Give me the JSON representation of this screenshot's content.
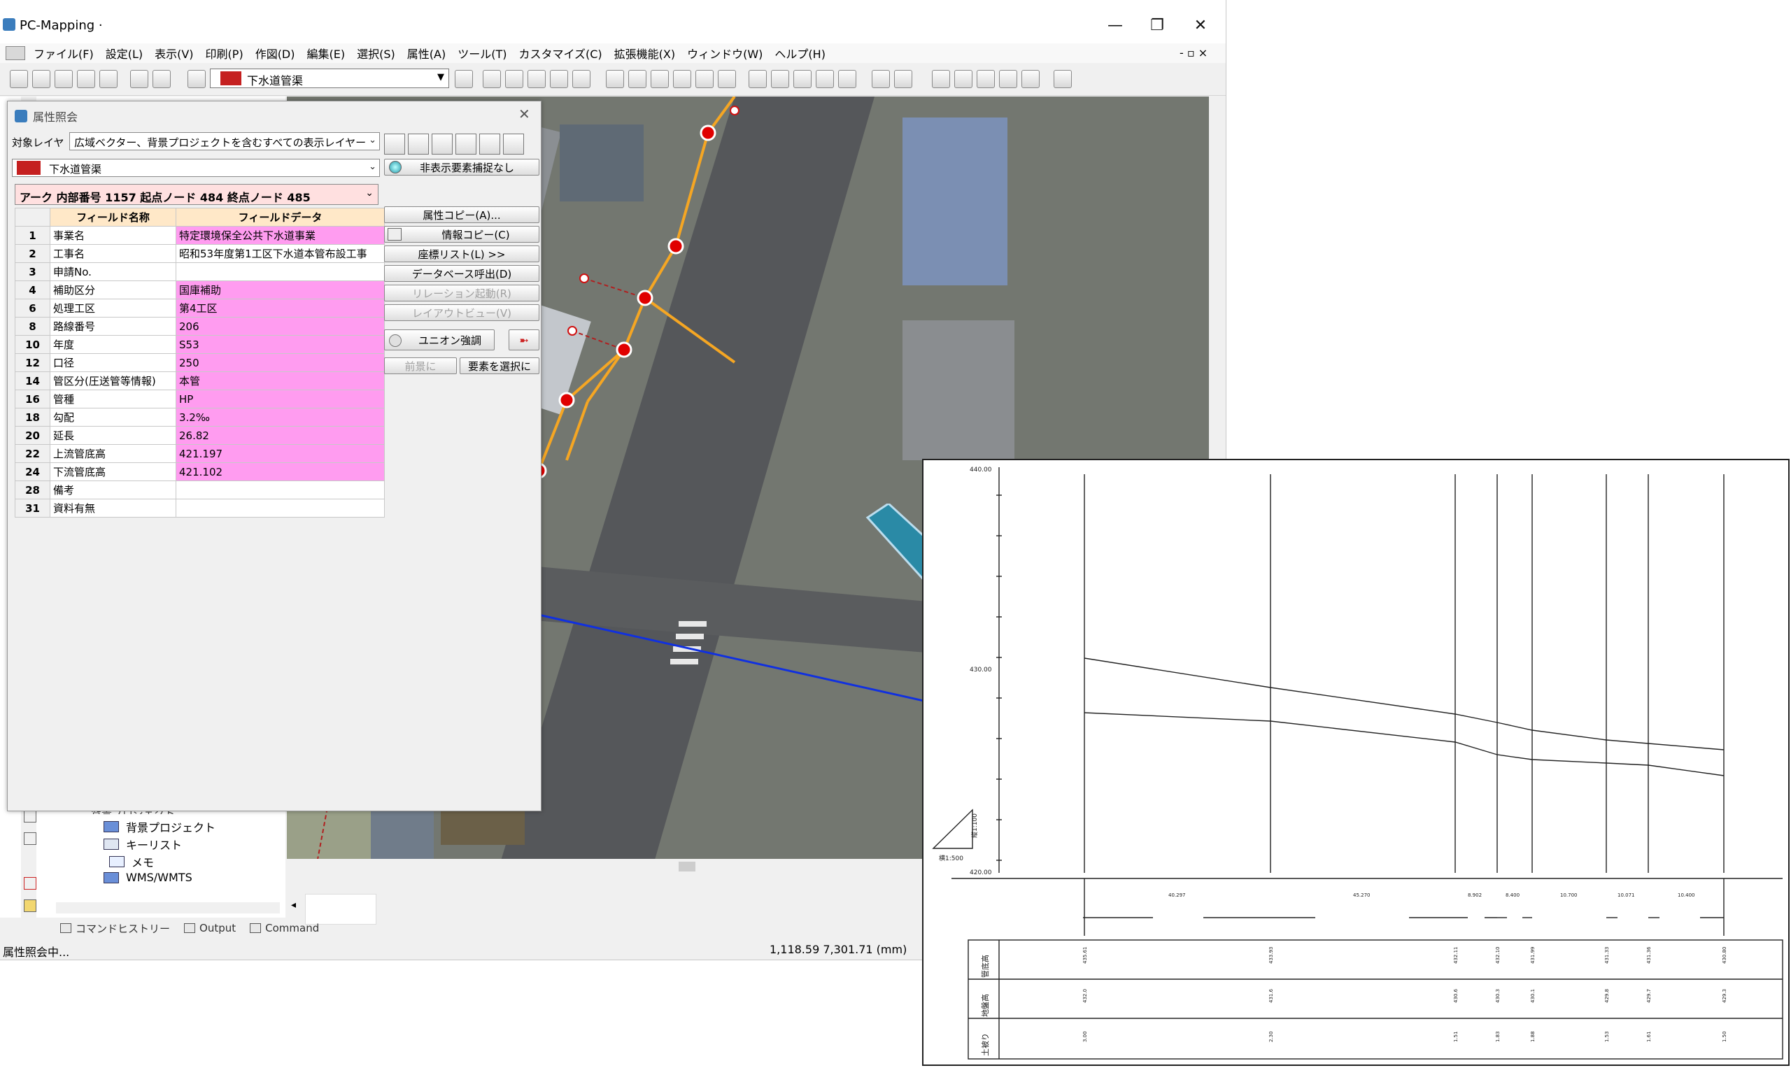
{
  "app": {
    "title": "PC-Mapping ·",
    "menu": [
      "ファイル(F)",
      "設定(L)",
      "表示(V)",
      "印刷(P)",
      "作図(D)",
      "編集(E)",
      "選択(S)",
      "属性(A)",
      "ツール(T)",
      "カスタマイズ(C)",
      "拡張機能(X)",
      "ウィンドウ(W)",
      "ヘルプ(H)"
    ],
    "window_buttons": {
      "minimize": "—",
      "restore": "❐",
      "close": "✕"
    },
    "inner_buttons": "- ▫ ×",
    "toolbar": {
      "layer_combo_value": "下水道管渠"
    }
  },
  "tree": {
    "cut_item": "背景プロジェクト",
    "items": [
      {
        "label": "背景プロジェクト",
        "icon": "folder-icon"
      },
      {
        "label": "キーリスト",
        "icon": "list-icon"
      },
      {
        "label": "メモ",
        "icon": "memo-icon"
      },
      {
        "label": "WMS/WMTS",
        "icon": "folder-icon"
      }
    ]
  },
  "bottom_tabs": [
    "コマンドヒストリー",
    "Output",
    "Command"
  ],
  "status": {
    "left": "属性照会中...",
    "coords": "1,118.59 7,301.71 (mm)"
  },
  "dialog": {
    "title": "属性照会",
    "target_layer_label": "対象レイヤ",
    "target_layer_value": "広域ベクター、背景プロジェクトを含むすべての表示レイヤー",
    "layer_value": "下水道管渠",
    "hidden_toggle": "非表示要素捕捉なし",
    "record": "アーク 内部番号 1157  起点ノード 484 終点ノード 485",
    "headers": {
      "field_name": "フィールド名称",
      "field_data": "フィールドデータ"
    },
    "rows": [
      {
        "no": "1",
        "name": "事業名",
        "value": "特定環境保全公共下水道事業",
        "hl": true
      },
      {
        "no": "2",
        "name": "工事名",
        "value": "昭和53年度第1工区下水道本管布設工事",
        "hl": false
      },
      {
        "no": "3",
        "name": "申請No.",
        "value": "",
        "hl": false
      },
      {
        "no": "4",
        "name": "補助区分",
        "value": "国庫補助",
        "hl": true
      },
      {
        "no": "6",
        "name": "処理工区",
        "value": "第4工区",
        "hl": true
      },
      {
        "no": "8",
        "name": "路線番号",
        "value": "206",
        "hl": true
      },
      {
        "no": "10",
        "name": "年度",
        "value": "S53",
        "hl": true
      },
      {
        "no": "12",
        "name": "口径",
        "value": "250",
        "hl": true
      },
      {
        "no": "14",
        "name": "管区分(圧送管等情報)",
        "value": "本管",
        "hl": true
      },
      {
        "no": "16",
        "name": "管種",
        "value": "HP",
        "hl": true
      },
      {
        "no": "18",
        "name": "勾配",
        "value": " 3.2‰",
        "hl": true
      },
      {
        "no": "20",
        "name": "延長",
        "value": "26.82",
        "hl": true
      },
      {
        "no": "22",
        "name": "上流管底高",
        "value": "421.197",
        "hl": true
      },
      {
        "no": "24",
        "name": "下流管底高",
        "value": "421.102",
        "hl": true
      },
      {
        "no": "28",
        "name": "備考",
        "value": "",
        "hl": false
      },
      {
        "no": "31",
        "name": "資料有無",
        "value": "",
        "hl": false
      }
    ],
    "buttons": {
      "attr_copy": "属性コピー(A)...",
      "info_copy": "情報コピー(C)",
      "coord_list": "座標リスト(L) >>",
      "db_call": "データベース呼出(D)",
      "relation": "リレーション起動(R)",
      "layout": "レイアウトビュー(V)",
      "union": "ユニオン強調",
      "prev": "前景に",
      "select": "要素を選択に"
    }
  },
  "profile": {
    "y_ticks": [
      "440.00",
      "430.00",
      "420.00"
    ],
    "slope_v": "縦1:100",
    "slope_h": "横1:500",
    "row_labels": [
      "管底高",
      "地盤高",
      "土被り"
    ],
    "spans": [
      "40.297",
      "45.270",
      "8.902",
      "8.400",
      "10.700",
      "10.071",
      "10.400"
    ],
    "upper_vals": [
      "435.61",
      "433.93",
      "432.11",
      "432.10",
      "431.99",
      "431.33",
      "431.36",
      "430.80"
    ],
    "mid_vals": [
      "432.0",
      "431.6",
      "430.6",
      "430.3",
      "430.1",
      "429.8",
      "429.7",
      "429.3"
    ],
    "low_vals": [
      "3.00",
      "2.30",
      "1.51",
      "1.83",
      "1.88",
      "1.53",
      "1.61",
      "1.50"
    ]
  },
  "colors": {
    "highlight": "#ff9cf0",
    "arrow": "#2a8aa6",
    "pipe": "#f5a623",
    "main_pipe": "#1030e0"
  }
}
